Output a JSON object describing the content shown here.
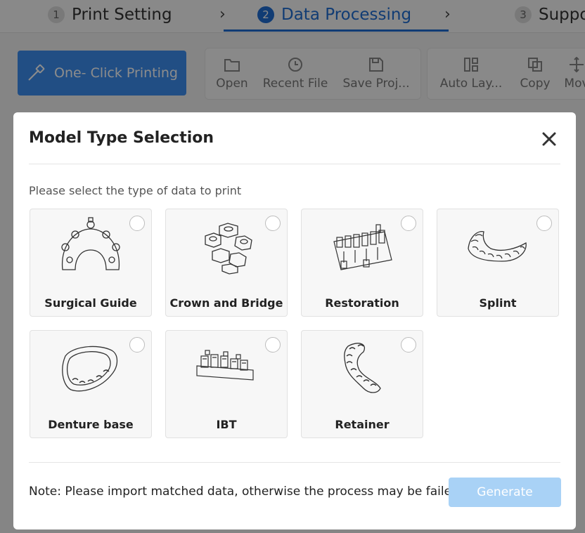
{
  "steps": [
    {
      "num": "1",
      "label": "Print Setting"
    },
    {
      "num": "2",
      "label": "Data Processing"
    },
    {
      "num": "3",
      "label": "Suppo"
    }
  ],
  "toolbar": {
    "primary_label": "One- Click Printing",
    "file_tools": [
      "Open",
      "Recent File",
      "Save Proj..."
    ],
    "edit_tools": [
      "Auto Lay...",
      "Copy",
      "Mov"
    ]
  },
  "modal": {
    "title": "Model Type Selection",
    "prompt": "Please select the type of data to print",
    "options": [
      {
        "label": "Surgical Guide",
        "icon": "surgical-guide-icon"
      },
      {
        "label": "Crown and Bridge",
        "icon": "crown-bridge-icon"
      },
      {
        "label": "Restoration",
        "icon": "restoration-icon"
      },
      {
        "label": "Splint",
        "icon": "splint-icon"
      },
      {
        "label": "Denture base",
        "icon": "denture-base-icon"
      },
      {
        "label": "IBT",
        "icon": "ibt-icon"
      },
      {
        "label": "Retainer",
        "icon": "retainer-icon"
      }
    ],
    "note": "Note: Please import matched data, otherwise the process may be failed!",
    "generate_label": "Generate"
  },
  "colors": {
    "accent": "#1f6ed4",
    "primary_button": "#3d8ef0",
    "generate_disabled": "#a9d2f6"
  }
}
